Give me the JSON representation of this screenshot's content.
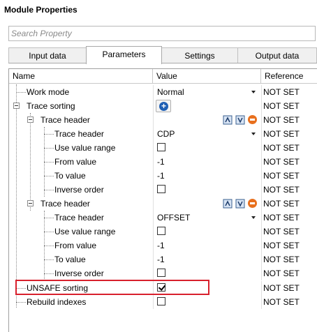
{
  "window": {
    "title": "Module Properties"
  },
  "search": {
    "placeholder": "Search Property"
  },
  "tabs": [
    {
      "label": "Input data",
      "active": false
    },
    {
      "label": "Parameters",
      "active": true
    },
    {
      "label": "Settings",
      "active": false
    },
    {
      "label": "Output data",
      "active": false
    }
  ],
  "columns": {
    "name": "Name",
    "value": "Value",
    "reference": "Reference"
  },
  "rows": [
    {
      "name": "Work mode",
      "value": "Normal",
      "type": "dropdown",
      "reference": "NOT SET"
    },
    {
      "name": "Trace sorting",
      "value": "",
      "type": "add-button",
      "reference": "NOT SET"
    },
    {
      "name": "Trace header",
      "value": "",
      "type": "header-group",
      "reference": "NOT SET"
    },
    {
      "name": "Trace header",
      "value": "CDP",
      "type": "dropdown",
      "reference": "NOT SET"
    },
    {
      "name": "Use value range",
      "value": "",
      "type": "checkbox",
      "checked": false,
      "reference": "NOT SET"
    },
    {
      "name": "From value",
      "value": "-1",
      "type": "text",
      "reference": "NOT SET"
    },
    {
      "name": "To value",
      "value": "-1",
      "type": "text",
      "reference": "NOT SET"
    },
    {
      "name": "Inverse order",
      "value": "",
      "type": "checkbox",
      "checked": false,
      "reference": "NOT SET"
    },
    {
      "name": "Trace header",
      "value": "",
      "type": "header-group",
      "reference": "NOT SET"
    },
    {
      "name": "Trace header",
      "value": "OFFSET",
      "type": "dropdown",
      "reference": "NOT SET"
    },
    {
      "name": "Use value range",
      "value": "",
      "type": "checkbox",
      "checked": false,
      "reference": "NOT SET"
    },
    {
      "name": "From value",
      "value": "-1",
      "type": "text",
      "reference": "NOT SET"
    },
    {
      "name": "To value",
      "value": "-1",
      "type": "text",
      "reference": "NOT SET"
    },
    {
      "name": "Inverse order",
      "value": "",
      "type": "checkbox",
      "checked": false,
      "reference": "NOT SET"
    },
    {
      "name": "UNSAFE sorting",
      "value": "",
      "type": "checkbox",
      "checked": true,
      "reference": "NOT SET"
    },
    {
      "name": "Rebuild indexes",
      "value": "",
      "type": "checkbox",
      "checked": false,
      "reference": "NOT SET"
    }
  ],
  "colors": {
    "highlight": "#d8202c",
    "add_icon": "#1f5fb4",
    "remove_icon": "#e8701e"
  },
  "icons": {
    "add": "plus-circle-icon",
    "move_up": "move-up-icon",
    "move_down": "move-down-icon",
    "remove": "remove-icon"
  }
}
